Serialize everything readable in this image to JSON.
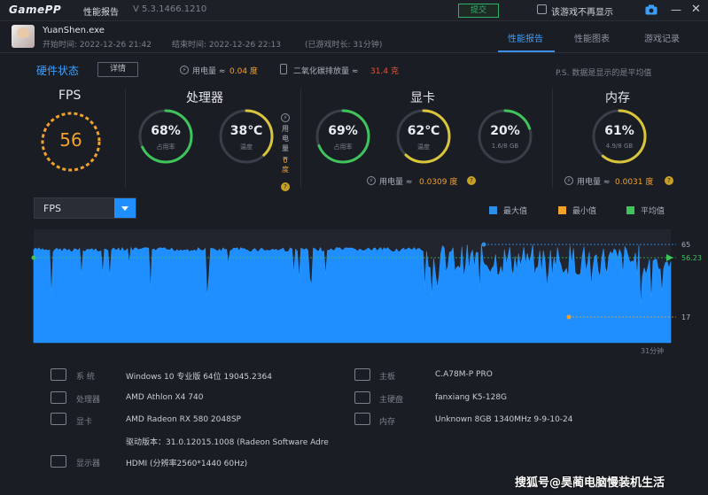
{
  "titlebar": {
    "logo": "GamePP",
    "title": "性能报告",
    "version": "V 5.3.1466.1210",
    "submit_label": "提交",
    "nodisplay_label": "该游戏不再显示",
    "icons": [
      "camera-icon",
      "minimize-icon",
      "close-icon"
    ]
  },
  "game": {
    "exe": "YuanShen.exe",
    "start_time": "开始时间: 2022-12-26 21:42",
    "end_time": "结束时间: 2022-12-26 22:13",
    "duration": "(已游戏时长: 31分钟)"
  },
  "tabs": [
    {
      "label": "性能报告",
      "active": true
    },
    {
      "label": "性能图表",
      "active": false
    },
    {
      "label": "游戏记录",
      "active": false
    }
  ],
  "status": {
    "hw_status_label": "硬件状态",
    "details_label": "详情",
    "power_label": "用电量 ≈",
    "power_value": "0.04 度",
    "co2_label": "二氧化碳排放量 ≈",
    "co2_value": "31.4 克",
    "note": "P.S. 数据是显示的是平均值"
  },
  "fps": {
    "title": "FPS",
    "value": "56",
    "color": "#f0a22b"
  },
  "cpu": {
    "title": "处理器",
    "util_value": "68%",
    "util_label": "占用率",
    "util_fraction": 0.68,
    "temp_value": "38℃",
    "temp_label": "温度",
    "temp_fraction": 0.38,
    "power_label": "用电量≈",
    "power_value": "0 度",
    "help": "?"
  },
  "gpu": {
    "title": "显卡",
    "util_value": "69%",
    "util_label": "占用率",
    "util_fraction": 0.69,
    "temp_value": "62℃",
    "temp_label": "温度",
    "temp_fraction": 0.62,
    "mem_value": "20%",
    "mem_label": "1.6/8 GB",
    "mem_fraction": 0.2,
    "power_label": "用电量 ≈",
    "power_value": "0.0309 度",
    "help": "?"
  },
  "memory": {
    "title": "内存",
    "util_value": "61%",
    "util_label": "4.9/8 GB",
    "util_fraction": 0.61,
    "power_label": "用电量 ≈",
    "power_value": "0.0031 度",
    "help": "?"
  },
  "chart_controls": {
    "metric": "FPS",
    "legend": [
      {
        "label": "最大值",
        "color": "#2b8fe8"
      },
      {
        "label": "最小值",
        "color": "#f0a22b"
      },
      {
        "label": "平均值",
        "color": "#3ec45b"
      }
    ],
    "end_label": "31分钟"
  },
  "chart_data": {
    "type": "area",
    "series_color": "#1f8fff",
    "max": 65,
    "min": 17,
    "avg": 56.23,
    "max_label": "65",
    "min_label": "17",
    "avg_label": "56.23",
    "ylim": [
      0,
      75
    ],
    "duration_minutes": 31
  },
  "hardware": {
    "os_key": "系 统",
    "os_val": "Windows 10 专业版 64位 19045.2364",
    "cpu_key": "处理器",
    "cpu_val": "AMD Athlon X4 740",
    "gpu_key": "显卡",
    "gpu_val": "AMD Radeon RX 580 2048SP",
    "driver_val": "驱动版本：31.0.12015.1008 (Radeon Software Adre",
    "display_key": "显示器",
    "display_val": "HDMI (分辨率2560*1440 60Hz)",
    "board_key": "主板",
    "board_val": "C.A78M-P PRO",
    "disk_key": "主硬盘",
    "disk_val": "fanxiang K5-128G",
    "ram_key": "内存",
    "ram_val": "Unknown 8GB 1340MHz 9-9-10-24"
  },
  "watermark": "搜狐号@昊蔺电脑慢装机生活"
}
